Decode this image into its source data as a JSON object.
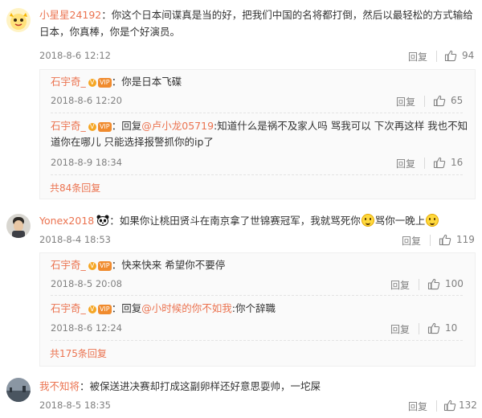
{
  "comments": [
    {
      "username": "小星星24192",
      "text": "：你这个日本间谍真是当的好，把我们中国的名将都打倒，然后以最轻松的方式输给日本，你真棒，你是个好演员。",
      "time": "2018-8-6 12:12",
      "reply_label": "回复",
      "likes": "94",
      "replies": [
        {
          "username": "石宇奇_",
          "reply_prefix": "",
          "mention": "",
          "text": "：你是日本飞碟",
          "time": "2018-8-6 12:20",
          "reply_label": "回复",
          "likes": "65"
        },
        {
          "username": "石宇奇_",
          "reply_prefix": "：回复",
          "mention": "@卢小龙05719",
          "text": ":知道什么是祸不及家人吗 骂我可以 下次再这样 我也不知道你在哪儿 只能选择报警抓你的ip了",
          "time": "2018-8-9 18:34",
          "reply_label": "回复",
          "likes": "16"
        }
      ],
      "more_label": "共84条回复"
    },
    {
      "username": "Yonex2018",
      "text": "：如果你让桃田贤斗在南京拿了世锦赛冠军，我就骂死你",
      "text_2": "骂你一晚上",
      "time": "2018-8-4 18:53",
      "reply_label": "回复",
      "likes": "119",
      "replies": [
        {
          "username": "石宇奇_",
          "reply_prefix": "",
          "mention": "",
          "text": "：快来快来 希望你不要停",
          "time": "2018-8-5 20:08",
          "reply_label": "回复",
          "likes": "100"
        },
        {
          "username": "石宇奇_",
          "reply_prefix": "：回复",
          "mention": "@小时候的你不如我",
          "text": ":你个辞職",
          "time": "2018-8-6 12:24",
          "reply_label": "回复",
          "likes": "10"
        }
      ],
      "more_label": "共175条回复"
    },
    {
      "username": "我不知将",
      "text": "：被保送进决赛却打成这副卵样还好意思耍帅，一坨屎",
      "time": "2018-8-5 18:35",
      "reply_label": "回复",
      "likes": "132"
    }
  ],
  "colors": {
    "username": "#eb7350",
    "meta": "#808080",
    "thread_bg": "#fafafa",
    "text": "#333333"
  },
  "icons": {
    "like": "thumbs-up-icon",
    "verified": "verified-v-icon",
    "vip": "vip-badge-icon",
    "emoji": "smile-emoji-icon",
    "panda": "panda-icon"
  }
}
